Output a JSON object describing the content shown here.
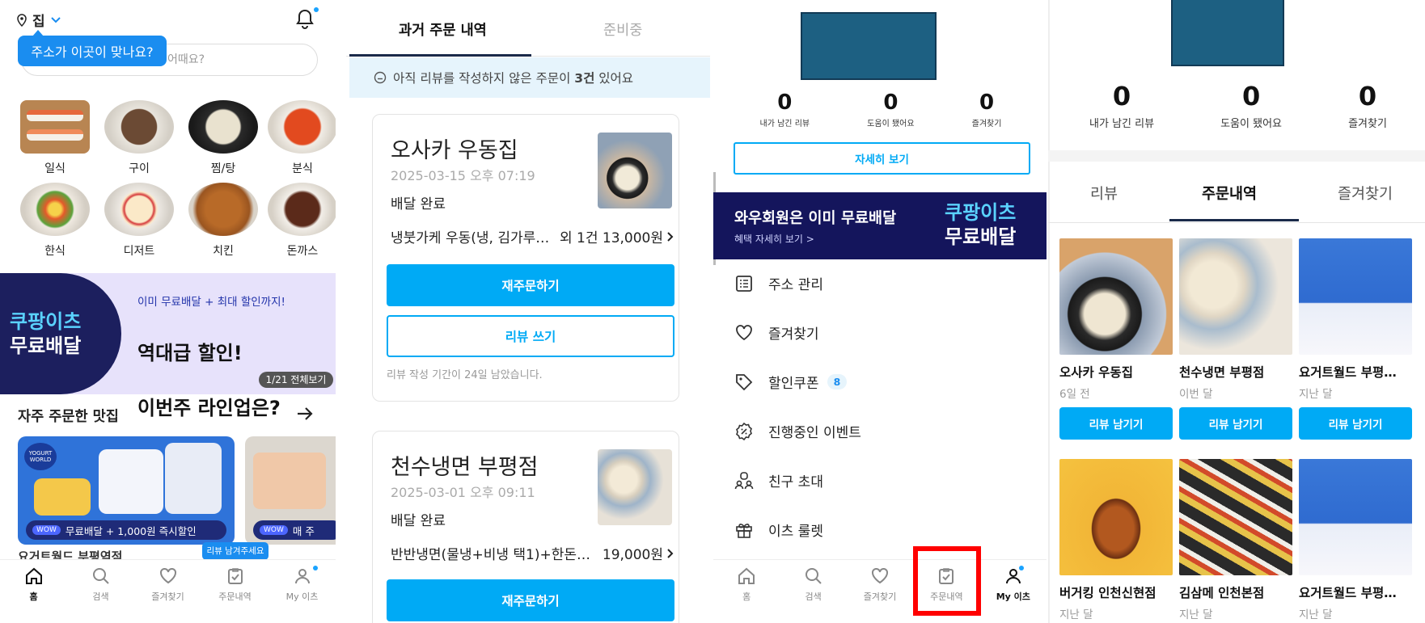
{
  "colors": {
    "accent": "#00aaf5",
    "navy": "#14155c",
    "highlight": "#ff0000"
  },
  "home": {
    "address": "집",
    "address_tooltip": "주소가 이곳이 맞나요?",
    "search_placeholder": "어때요?",
    "categories": [
      {
        "label": "일식",
        "icon": "sushi"
      },
      {
        "label": "구이",
        "icon": "grilled-meat"
      },
      {
        "label": "찜/탕",
        "icon": "stew"
      },
      {
        "label": "분식",
        "icon": "tteokbokki"
      },
      {
        "label": "한식",
        "icon": "bibimbap"
      },
      {
        "label": "디저트",
        "icon": "cake"
      },
      {
        "label": "치킨",
        "icon": "chicken"
      },
      {
        "label": "돈까스",
        "icon": "pork-cutlet"
      }
    ],
    "banner": {
      "logo_line1": "쿠팡이츠",
      "logo_line2": "무료배달",
      "subtitle": "이미 무료배달 + 최대 할인까지!",
      "headline_line1": "역대급 할인!",
      "headline_line2": "이번주 라인업은?",
      "page_indicator": "1/21 전체보기"
    },
    "frequent_title": "자주 주문한 맛집",
    "frequent_card1": {
      "logo": "YOGURT WORLD",
      "wow_tag": "WOW",
      "promo": "무료배달 + 1,000원 즉시할인"
    },
    "frequent_card2": {
      "wow_tag": "WOW",
      "promo": "매 주"
    },
    "peek_text": "요거트월드 부평역점",
    "review_tip": "리뷰 남겨주세요"
  },
  "nav1": [
    {
      "label": "홈",
      "icon": "home-icon"
    },
    {
      "label": "검색",
      "icon": "search-icon"
    },
    {
      "label": "즐겨찾기",
      "icon": "heart-icon"
    },
    {
      "label": "주문내역",
      "icon": "order-icon"
    },
    {
      "label": "My 이츠",
      "icon": "user-icon"
    }
  ],
  "orders": {
    "tab_past": "과거 주문 내역",
    "tab_preparing": "준비중",
    "notice_prefix": "아직 리뷰를 작성하지 않은 주문이 ",
    "notice_count": "3건",
    "notice_suffix": " 있어요",
    "cards": [
      {
        "name": "오사카 우동집",
        "date": "2025-03-15 오후 07:19",
        "status": "배달 완료",
        "items": "냉붓가케 우동(냉, 김가루…",
        "price": "외 1건 13,000원",
        "reorder": "재주문하기",
        "review": "리뷰 쓰기",
        "deadline": "리뷰 작성 기간이 24일 남았습니다."
      },
      {
        "name": "천수냉면 부평점",
        "date": "2025-03-01 오후 09:11",
        "status": "배달 완료",
        "items": "반반냉면(물냉+비냉 택1)+한돈…",
        "price": "19,000원",
        "reorder": "재주문하기"
      }
    ]
  },
  "myeats": {
    "stats": [
      {
        "value": "0",
        "label": "내가 남긴 리뷰"
      },
      {
        "value": "0",
        "label": "도움이 됐어요"
      },
      {
        "value": "0",
        "label": "즐겨찾기"
      }
    ],
    "detail_button": "자세히 보기",
    "banner": {
      "headline": "와우회원은 이미 무료배달",
      "sub": "혜택 자세히 보기 >",
      "logo_line1": "쿠팡이츠",
      "logo_line2": "무료배달"
    },
    "menu": [
      {
        "label": "주소 관리",
        "icon": "list-icon"
      },
      {
        "label": "즐겨찾기",
        "icon": "heart-icon"
      },
      {
        "label": "할인쿠폰",
        "icon": "tag-icon",
        "badge": "8"
      },
      {
        "label": "진행중인 이벤트",
        "icon": "percent-badge-icon"
      },
      {
        "label": "친구 초대",
        "icon": "friends-icon"
      },
      {
        "label": "이츠 룰렛",
        "icon": "gift-icon"
      }
    ]
  },
  "nav3": [
    {
      "label": "홈",
      "icon": "home-icon"
    },
    {
      "label": "검색",
      "icon": "search-icon"
    },
    {
      "label": "즐겨찾기",
      "icon": "heart-icon"
    },
    {
      "label": "주문내역",
      "icon": "order-icon"
    },
    {
      "label": "My 이츠",
      "icon": "user-icon"
    }
  ],
  "profile": {
    "stats": [
      {
        "value": "0",
        "label": "내가 남긴 리뷰"
      },
      {
        "value": "0",
        "label": "도움이 됐어요"
      },
      {
        "value": "0",
        "label": "즐겨찾기"
      }
    ],
    "tabs": [
      "리뷰",
      "주문내역",
      "즐겨찾기"
    ],
    "tiles": [
      {
        "name": "오사카 우동집",
        "when": "6일 전",
        "button": "리뷰 남기기"
      },
      {
        "name": "천수냉면 부평점",
        "when": "이번 달",
        "button": "리뷰 남기기"
      },
      {
        "name": "요거트월드 부평…",
        "when": "지난 달",
        "button": "리뷰 남기기"
      },
      {
        "name": "버거킹 인천신현점",
        "when": "지난 달"
      },
      {
        "name": "김삼메 인천본점",
        "when": "지난 달"
      },
      {
        "name": "요거트월드 부평…",
        "when": "지난 달"
      }
    ]
  }
}
